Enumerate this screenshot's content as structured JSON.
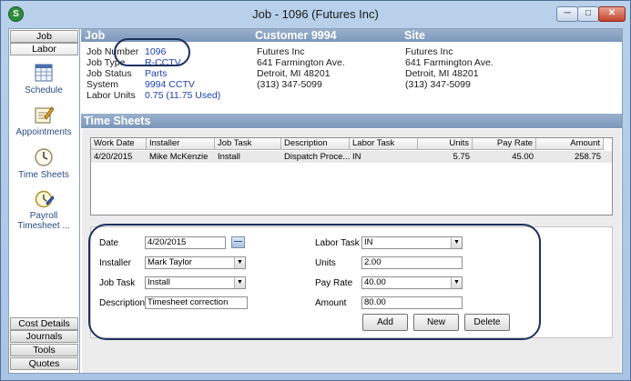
{
  "window": {
    "app_icon": "S",
    "title": "Job - 1096 (Futures  Inc)",
    "min_glyph": "─",
    "max_glyph": "□",
    "close_glyph": "✕"
  },
  "sidebar": {
    "top_tabs": [
      {
        "label": "Job"
      },
      {
        "label": "Labor"
      }
    ],
    "items": [
      {
        "label": "Schedule",
        "icon": "schedule-icon"
      },
      {
        "label": "Appointments",
        "icon": "appointments-icon"
      },
      {
        "label": "Time Sheets",
        "icon": "clock-icon"
      },
      {
        "label": "Payroll Timesheet ...",
        "icon": "payroll-timesheet-icon"
      }
    ],
    "bottom_tabs": [
      {
        "label": "Cost Details"
      },
      {
        "label": "Journals"
      },
      {
        "label": "Tools"
      },
      {
        "label": "Quotes"
      }
    ]
  },
  "job_header": {
    "job_title": "Job",
    "customer_title": "Customer 9994",
    "site_title": "Site",
    "fields": [
      {
        "label": "Job Number",
        "value": "1096"
      },
      {
        "label": "Job Type",
        "value": "R-CCTV"
      },
      {
        "label": "Job Status",
        "value": "Parts"
      },
      {
        "label": "System",
        "value": "9994 CCTV"
      },
      {
        "label": "Labor Units",
        "value": "0.75 (11.75 Used)"
      }
    ],
    "customer_address": [
      "Futures  Inc",
      "641 Farmington Ave.",
      "Detroit, MI 48201",
      "(313) 347-5099"
    ],
    "site_address": [
      "Futures  Inc",
      "641 Farmington Ave.",
      "Detroit, MI 48201",
      "(313) 347-5099"
    ]
  },
  "time_sheets": {
    "title": "Time Sheets",
    "columns": [
      "Work Date",
      "Installer",
      "Job Task",
      "Description",
      "Labor Task",
      "Units",
      "Pay Rate",
      "Amount"
    ],
    "rows": [
      [
        "4/20/2015",
        "Mike McKenzie",
        "Install",
        "Dispatch Proce...",
        "IN",
        "5.75",
        "45.00",
        "258.75"
      ]
    ]
  },
  "form": {
    "date_label": "Date",
    "date_value": "4/20/2015",
    "installer_label": "Installer",
    "installer_value": "Mark Taylor",
    "job_task_label": "Job Task",
    "job_task_value": "Install",
    "description_label": "Description",
    "description_value": "Timesheet correction",
    "labor_task_label": "Labor Task",
    "labor_task_value": "IN",
    "units_label": "Units",
    "units_value": "2.00",
    "pay_rate_label": "Pay Rate",
    "pay_rate_value": "40.00",
    "amount_label": "Amount",
    "amount_value": "80.00",
    "add_label": "Add",
    "new_label": "New",
    "delete_label": "Delete"
  },
  "colors": {
    "header_bar": "#7b97bb",
    "link_value": "#1f3fae",
    "annotation": "#1d3160"
  }
}
